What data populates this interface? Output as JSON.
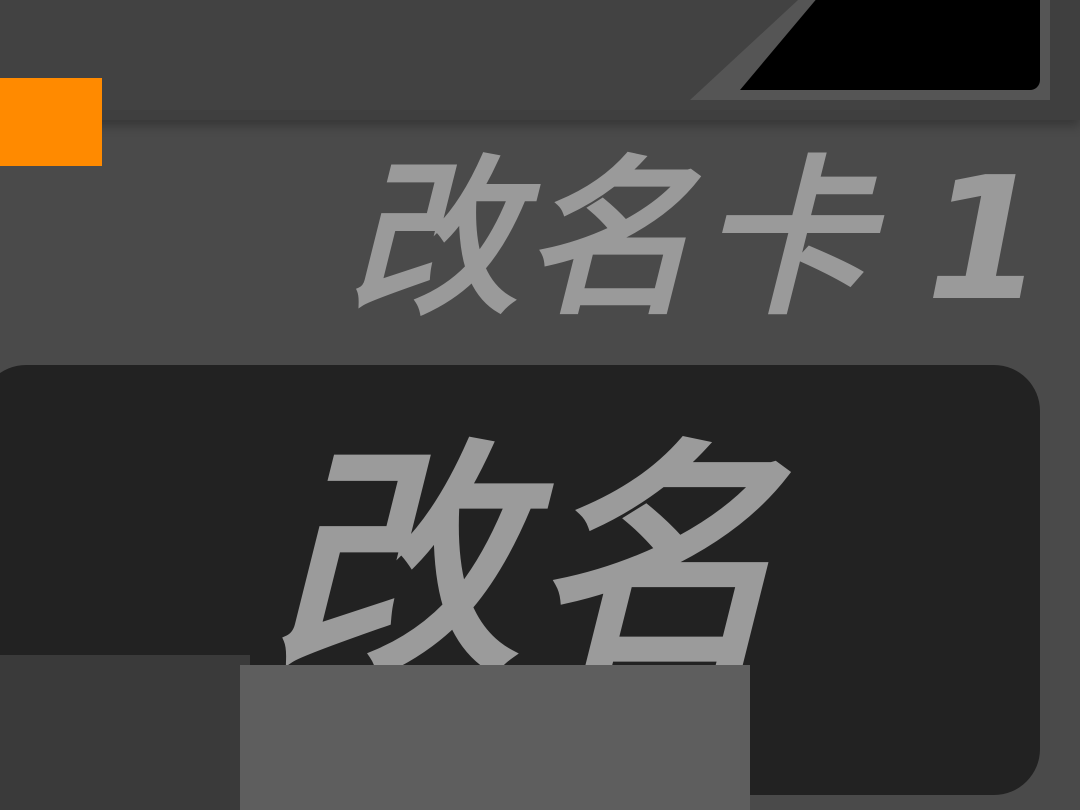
{
  "item": {
    "name": "改名卡",
    "count": "1"
  },
  "rename_button": {
    "label": "改名"
  },
  "colors": {
    "accent": "#ff8a00",
    "background": "#4a4a4a",
    "button_bg": "#222222",
    "text": "#9a9a9a",
    "corner_panel": "#000000"
  }
}
